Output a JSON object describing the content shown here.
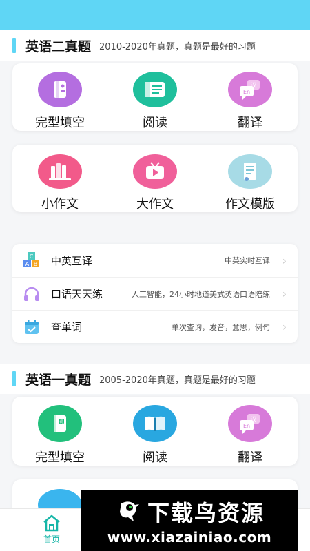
{
  "section1": {
    "title": "英语二真题",
    "subtitle": "2010-2020年真题，真题是最好的习题",
    "row1": [
      {
        "label": "完型填空",
        "icon": "notebook-icon",
        "color": "#b46ee0"
      },
      {
        "label": "阅读",
        "icon": "document-icon",
        "color": "#1fbf9c"
      },
      {
        "label": "翻译",
        "icon": "translate-bubble-icon",
        "color": "#d77ad9"
      }
    ],
    "row2": [
      {
        "label": "小作文",
        "icon": "books-icon",
        "color": "#f25a8a"
      },
      {
        "label": "大作文",
        "icon": "tv-icon",
        "color": "#f0609a"
      },
      {
        "label": "作文模版",
        "icon": "scroll-icon",
        "color": "#a7dbe6"
      }
    ]
  },
  "tools": [
    {
      "title": "中英互译",
      "desc": "中英实时互译",
      "icon": "abc-blocks-icon"
    },
    {
      "title": "口语天天练",
      "desc": "人工智能，24小时地道美式英语口语陪练",
      "icon": "headphones-icon"
    },
    {
      "title": "查单词",
      "desc": "单次查询，发音，意思，例句",
      "icon": "calendar-check-icon"
    }
  ],
  "section2": {
    "title": "英语一真题",
    "subtitle": "2005-2020年真题，真题是最好的习题",
    "row1": [
      {
        "label": "完型填空",
        "icon": "word-book-icon",
        "color": "#22c07c"
      },
      {
        "label": "阅读",
        "icon": "open-book-icon",
        "color": "#29a7e0"
      },
      {
        "label": "翻译",
        "icon": "translate-bubble-icon",
        "color": "#d77ad9"
      }
    ]
  },
  "tabbar": {
    "home_label": "首页"
  },
  "watermark": {
    "text": "下载鸟资源",
    "url": "www.xiazainiao.com"
  }
}
